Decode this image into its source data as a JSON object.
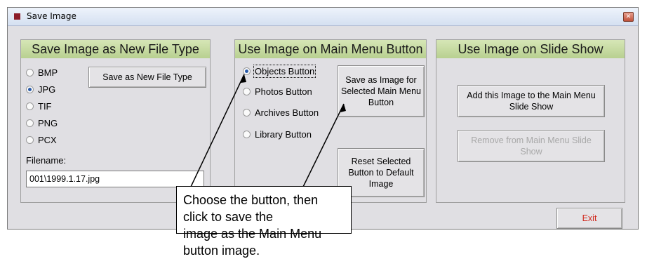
{
  "window": {
    "title": "Save Image",
    "close_glyph": "✕"
  },
  "panel_file_type": {
    "header": "Save Image as New File Type",
    "options": [
      {
        "label": "BMP",
        "checked": false
      },
      {
        "label": "JPG",
        "checked": true
      },
      {
        "label": "TIF",
        "checked": false
      },
      {
        "label": "PNG",
        "checked": false
      },
      {
        "label": "PCX",
        "checked": false
      }
    ],
    "save_button": "Save as New File Type",
    "filename_label": "Filename:",
    "filename_value": "001\\1999.1.17.jpg"
  },
  "panel_main_menu": {
    "header": "Use Image on Main Menu Button",
    "options": [
      {
        "label": "Objects Button",
        "checked": true
      },
      {
        "label": "Photos Button",
        "checked": false
      },
      {
        "label": "Archives Button",
        "checked": false
      },
      {
        "label": "Library Button",
        "checked": false
      }
    ],
    "save_button": "Save as Image for Selected Main Menu Button",
    "reset_button": "Reset Selected Button to Default Image"
  },
  "panel_slide_show": {
    "header": "Use Image on Slide Show",
    "add_button": "Add this Image to the Main Menu Slide Show",
    "remove_button": "Remove from Main Menu Slide Show"
  },
  "exit_button": "Exit",
  "callout": {
    "line1": "Choose the button, then click to save the",
    "line2": "image as the Main Menu button image."
  },
  "colors": {
    "header_green": "#c4d8a0",
    "accent_radio": "#2a5aa8",
    "exit_red": "#d0281c",
    "title_icon": "#8b1c28"
  }
}
